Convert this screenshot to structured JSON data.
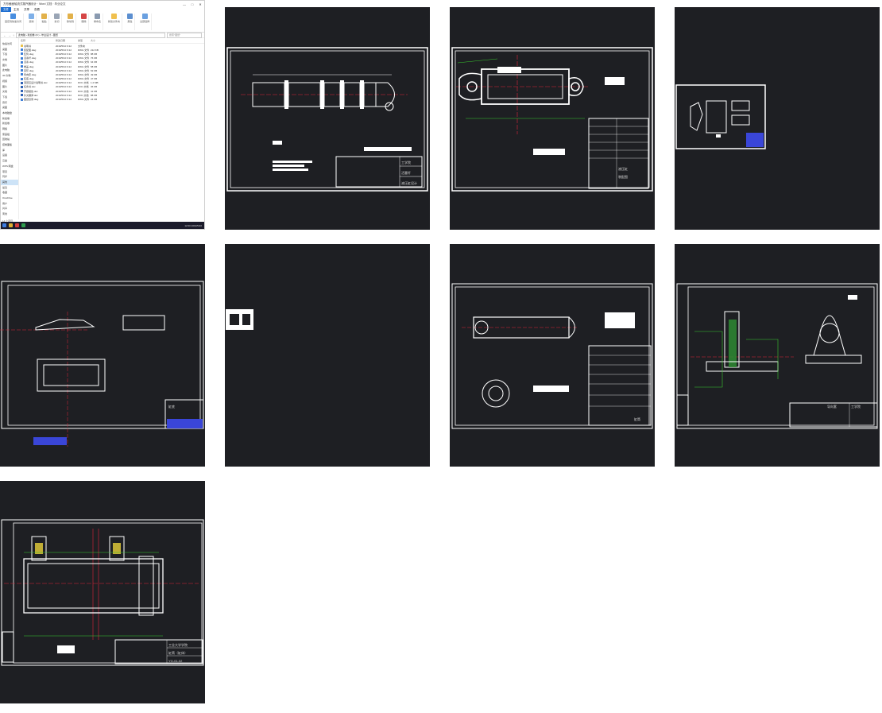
{
  "explorer": {
    "window_title": "方形截面轴流式凝汽器设计 · Word 文档 · 毕业论文",
    "window_controls": [
      "—",
      "□",
      "✕"
    ],
    "tabs": [
      "文件",
      "主页",
      "共享",
      "查看"
    ],
    "ribbon_groups": [
      "固定到快速访问",
      "复制",
      "粘贴",
      "剪切",
      "复制路径",
      "移动到",
      "复制到",
      "删除",
      "重命名",
      "新建文件夹",
      "属性",
      "打开",
      "全部选择"
    ],
    "address_path": "此电脑 › 新加卷 (D:) › 毕业设计 › 图纸",
    "search_placeholder": "搜索\"图纸\"",
    "nav_items": [
      "快速访问",
      "桌面",
      "下载",
      "文档",
      "图片",
      "此电脑",
      "3D 对象",
      "视频",
      "图片",
      "文档",
      "下载",
      "音乐",
      "桌面",
      "本地磁盘",
      "新加卷",
      "新加卷",
      "网络",
      "家庭组",
      "回收站",
      "控制面板",
      "库",
      "设备",
      "云盘",
      "WPS 网盘",
      "项目",
      "同步",
      "其他",
      "最近",
      "收藏",
      "OneDrive",
      "用户",
      "共享",
      "离线"
    ],
    "columns": [
      "名称",
      "修改日期",
      "类型",
      "大小"
    ],
    "files": [
      {
        "name": "说明书",
        "date": "2019/5/10 9:12",
        "type": "文件夹",
        "size": ""
      },
      {
        "name": "装配图.dwg",
        "date": "2019/5/10 9:12",
        "type": "DWG 文件",
        "size": "212 KB"
      },
      {
        "name": "缸筒.dwg",
        "date": "2019/5/10 9:12",
        "type": "DWG 文件",
        "size": "88 KB"
      },
      {
        "name": "活塞杆.dwg",
        "date": "2019/5/10 9:12",
        "type": "DWG 文件",
        "size": "76 KB"
      },
      {
        "name": "活塞.dwg",
        "date": "2019/5/10 9:12",
        "type": "DWG 文件",
        "size": "64 KB"
      },
      {
        "name": "端盖.dwg",
        "date": "2019/5/10 9:12",
        "type": "DWG 文件",
        "size": "58 KB"
      },
      {
        "name": "耳环.dwg",
        "date": "2019/5/10 9:12",
        "type": "DWG 文件",
        "size": "52 KB"
      },
      {
        "name": "导向套.dwg",
        "date": "2019/5/10 9:12",
        "type": "DWG 文件",
        "size": "49 KB"
      },
      {
        "name": "缸底.dwg",
        "date": "2019/5/10 9:12",
        "type": "DWG 文件",
        "size": "47 KB"
      },
      {
        "name": "液压缸设计说明书.doc",
        "date": "2019/5/10 9:12",
        "type": "DOC 文档",
        "size": "1.2 MB"
      },
      {
        "name": "任务书.doc",
        "date": "2019/5/10 9:12",
        "type": "DOC 文档",
        "size": "36 KB"
      },
      {
        "name": "开题报告.doc",
        "date": "2019/5/10 9:12",
        "type": "DOC 文档",
        "size": "41 KB"
      },
      {
        "name": "外文翻译.doc",
        "date": "2019/5/10 9:12",
        "type": "DOC 文档",
        "size": "88 KB"
      },
      {
        "name": "图纸目录.dwg",
        "date": "2019/5/10 9:12",
        "type": "DWG 文件",
        "size": "24 KB"
      }
    ],
    "status": "14 个项目",
    "clock": "12:00 2019/5/10"
  },
  "drawings": [
    {
      "title_block": [
        "工学院",
        "活塞杆",
        "液压缸设计"
      ],
      "note_lines": 4
    },
    {
      "title_block": [
        "液压缸",
        "装配图"
      ]
    },
    {},
    {
      "title_block": [
        "缸底"
      ]
    },
    {},
    {
      "title_block": [
        "缸筒"
      ]
    },
    {
      "title_block": [
        "导向套",
        "工学院"
      ]
    },
    {
      "title_block": [
        "工业大学学院",
        "缸筒（缸体）",
        "YG-01-02"
      ]
    }
  ],
  "colors": {
    "cad_bg": "#1e1f23",
    "cad_line": "#ffffff",
    "cad_dim": "#39c92e",
    "cad_center": "#e0243a",
    "cad_blue": "#3a46d8",
    "cad_yellow": "#e8d13a"
  }
}
